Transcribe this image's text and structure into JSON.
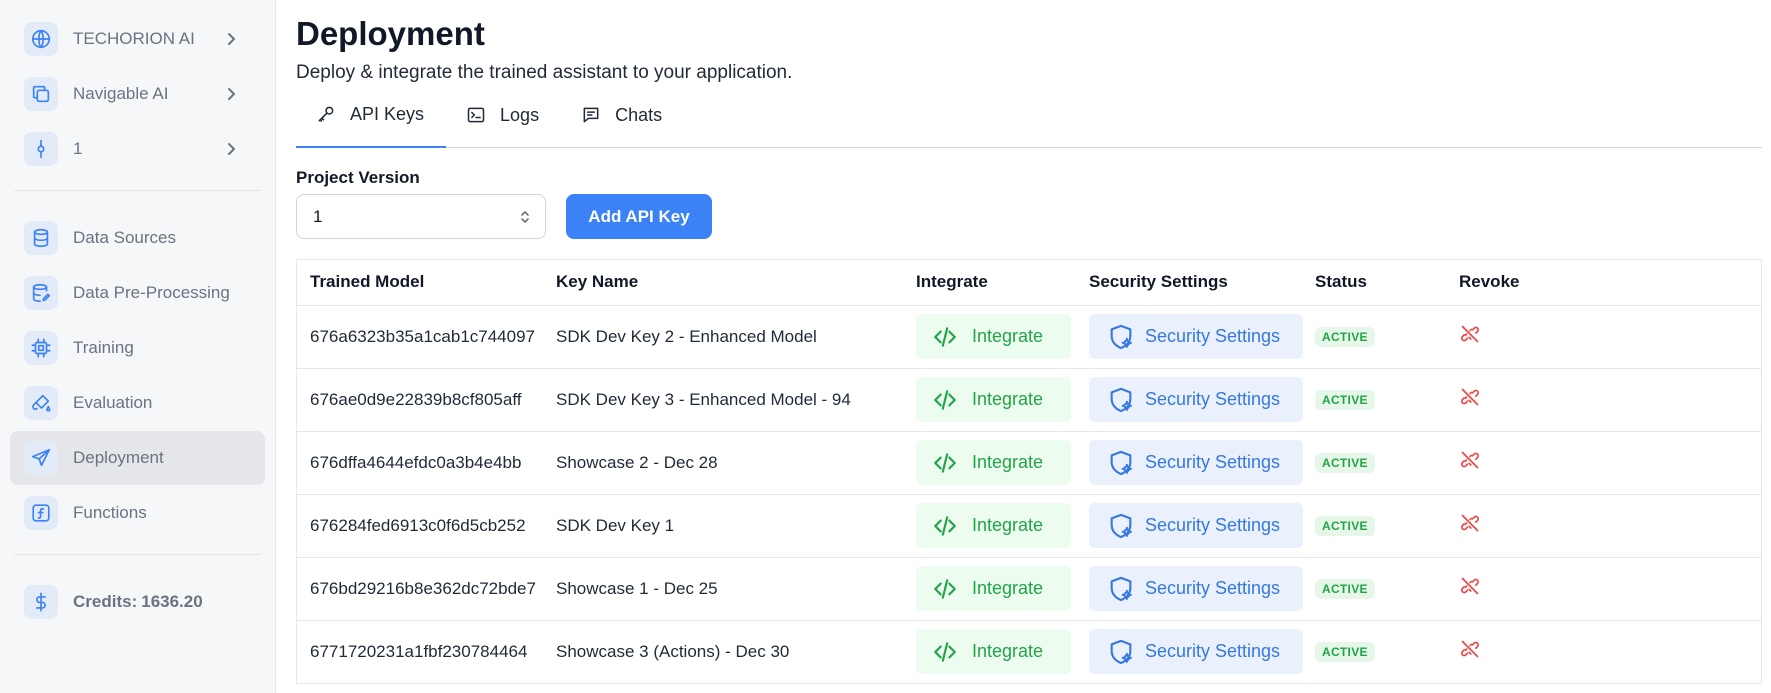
{
  "sidebar": {
    "context": [
      {
        "label": "TECHORION AI",
        "icon": "globe-icon"
      },
      {
        "label": "Navigable AI",
        "icon": "copy-icon"
      },
      {
        "label": "1",
        "icon": "commit-icon"
      }
    ],
    "nav": [
      {
        "label": "Data Sources",
        "icon": "database-icon"
      },
      {
        "label": "Data Pre-Processing",
        "icon": "database-edit-icon"
      },
      {
        "label": "Training",
        "icon": "cpu-icon"
      },
      {
        "label": "Evaluation",
        "icon": "brush-icon"
      },
      {
        "label": "Deployment",
        "icon": "send-icon",
        "active": true
      },
      {
        "label": "Functions",
        "icon": "function-icon"
      }
    ],
    "credits": {
      "label": "Credits:",
      "value": "1636.20",
      "icon": "dollar-icon"
    }
  },
  "header": {
    "title": "Deployment",
    "subtitle": "Deploy & integrate the trained assistant to your application."
  },
  "tabs": [
    {
      "label": "API Keys",
      "icon": "key-icon",
      "active": true
    },
    {
      "label": "Logs",
      "icon": "terminal-icon"
    },
    {
      "label": "Chats",
      "icon": "message-icon"
    }
  ],
  "controls": {
    "version_label": "Project Version",
    "version_value": "1",
    "add_button": "Add API Key"
  },
  "table": {
    "headers": [
      "Trained Model",
      "Key Name",
      "Integrate",
      "Security Settings",
      "Status",
      "Revoke"
    ],
    "integrate_label": "Integrate",
    "security_label": "Security Settings",
    "rows": [
      {
        "model": "676a6323b35a1cab1c744097",
        "key_name": "SDK Dev Key 2 - Enhanced Model",
        "status": "ACTIVE"
      },
      {
        "model": "676ae0d9e22839b8cf805aff",
        "key_name": "SDK Dev Key 3 - Enhanced Model - 94",
        "status": "ACTIVE"
      },
      {
        "model": "676dffa4644efdc0a3b4e4bb",
        "key_name": "Showcase 2 - Dec 28",
        "status": "ACTIVE"
      },
      {
        "model": "676284fed6913c0f6d5cb252",
        "key_name": "SDK Dev Key 1",
        "status": "ACTIVE"
      },
      {
        "model": "676bd29216b8e362dc72bde7",
        "key_name": "Showcase 1 - Dec 25",
        "status": "ACTIVE"
      },
      {
        "model": "6771720231a1fbf230784464",
        "key_name": "Showcase 3 (Actions) - Dec 30",
        "status": "ACTIVE"
      }
    ]
  },
  "colors": {
    "accent": "#3b82f6",
    "success": "#22a447",
    "danger": "#ef4444"
  }
}
